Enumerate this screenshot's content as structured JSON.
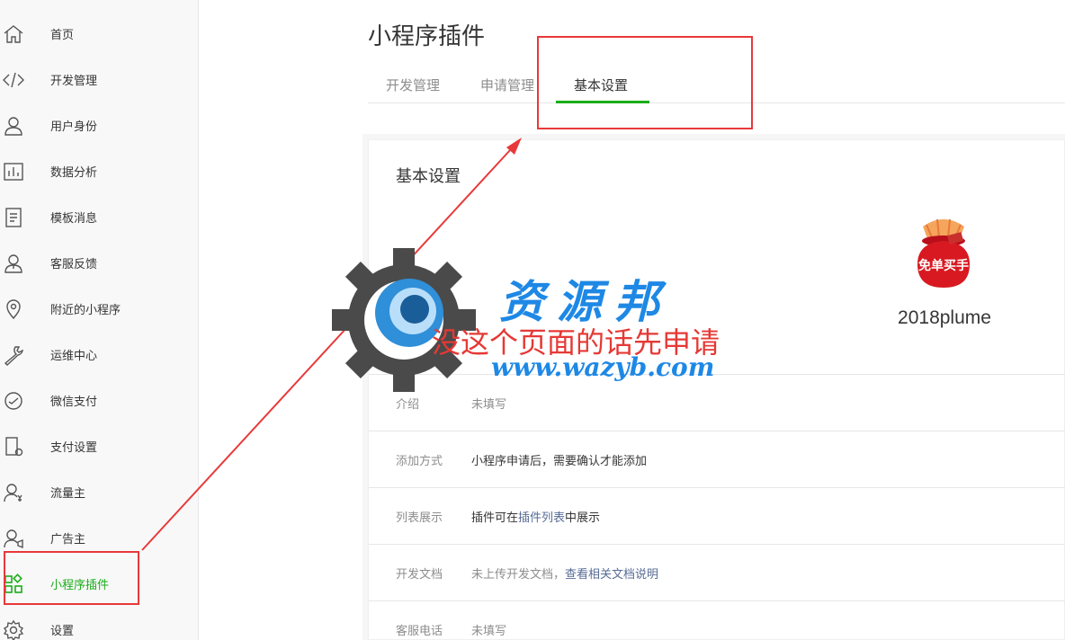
{
  "sidebar": {
    "items": [
      {
        "label": "首页",
        "icon": "home-icon"
      },
      {
        "label": "开发管理",
        "icon": "code-icon"
      },
      {
        "label": "用户身份",
        "icon": "user-icon"
      },
      {
        "label": "数据分析",
        "icon": "bar-chart-icon"
      },
      {
        "label": "模板消息",
        "icon": "document-icon"
      },
      {
        "label": "客服反馈",
        "icon": "customer-service-icon"
      },
      {
        "label": "附近的小程序",
        "icon": "location-pin-icon"
      },
      {
        "label": "运维中心",
        "icon": "wrench-icon"
      },
      {
        "label": "微信支付",
        "icon": "payment-icon"
      },
      {
        "label": "支付设置",
        "icon": "payment-settings-icon"
      },
      {
        "label": "流量主",
        "icon": "traffic-owner-icon"
      },
      {
        "label": "广告主",
        "icon": "advertiser-icon"
      },
      {
        "label": "小程序插件",
        "icon": "plugin-grid-icon",
        "active": true
      },
      {
        "label": "设置",
        "icon": "gear-icon"
      }
    ]
  },
  "header": {
    "title": "小程序插件"
  },
  "tabs": [
    {
      "label": "开发管理"
    },
    {
      "label": "申请管理"
    },
    {
      "label": "基本设置",
      "active": true
    }
  ],
  "card": {
    "title": "基本设置",
    "plugin": {
      "name": "2018plume",
      "avatar_text": "免单买手"
    },
    "rows": [
      {
        "label": "介绍",
        "value": "未填写"
      },
      {
        "label": "添加方式",
        "value": "小程序申请后，需要确认才能添加"
      },
      {
        "label": "列表展示",
        "value_prefix": "插件可在",
        "link": "插件列表",
        "value_suffix": "中展示"
      },
      {
        "label": "开发文档",
        "value_prefix": "未上传开发文档，",
        "link": "查看相关文档说明"
      },
      {
        "label": "客服电话",
        "value": "未填写"
      }
    ]
  },
  "watermark": {
    "brand": "资源邦",
    "note": "没这个页面的话先申请",
    "url": "www.wazyb.com"
  },
  "colors": {
    "accent": "#1aad19",
    "annotation": "#e8393a",
    "link": "#576b95",
    "watermark_blue": "#1e88e5"
  }
}
